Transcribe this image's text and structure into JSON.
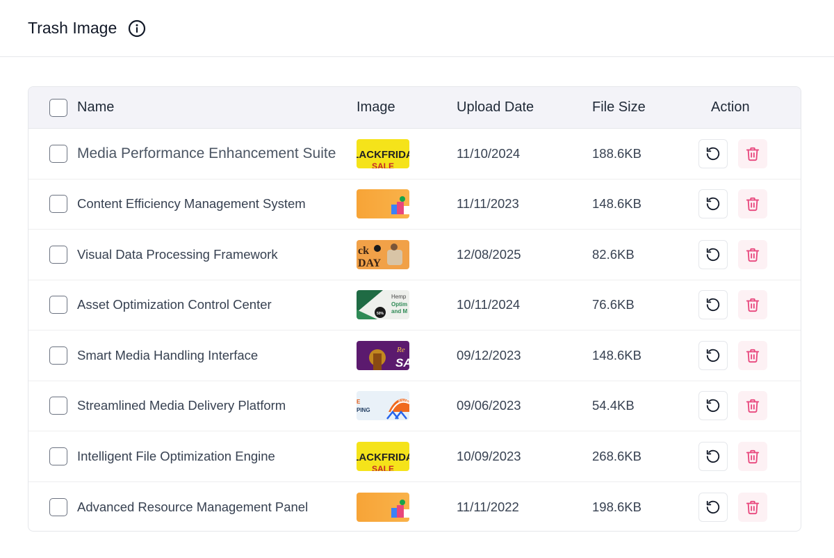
{
  "header": {
    "title": "Trash Image",
    "info_icon": "info-icon"
  },
  "table": {
    "columns": {
      "name": "Name",
      "image": "Image",
      "upload_date": "Upload Date",
      "file_size": "File Size",
      "action": "Action"
    },
    "rows": [
      {
        "name": "Media Performance Enhancement Suite",
        "thumb": "black-friday",
        "thumb_text": "LACKFRIDA SALE",
        "date": "11/10/2024",
        "size": "188.6KB"
      },
      {
        "name": "Content Efficiency Management System",
        "thumb": "orange-shopping",
        "thumb_text": "",
        "date": "11/11/2023",
        "size": "148.6KB"
      },
      {
        "name": "Visual Data Processing Framework",
        "thumb": "orange-day",
        "thumb_text": "ck DAY",
        "date": "12/08/2025",
        "size": "82.6KB"
      },
      {
        "name": "Asset Optimization Control Center",
        "thumb": "green-hemp",
        "thumb_text": "Hemp Optim and M",
        "date": "10/11/2024",
        "size": "76.6KB"
      },
      {
        "name": "Smart Media Handling Interface",
        "thumb": "purple-sale",
        "thumb_text": "Re SA",
        "date": "09/12/2023",
        "size": "148.6KB"
      },
      {
        "name": "Streamlined Media Delivery Platform",
        "thumb": "store-shipping",
        "thumb_text": "E PING STORE",
        "date": "09/06/2023",
        "size": "54.4KB"
      },
      {
        "name": "Intelligent File Optimization Engine",
        "thumb": "black-friday",
        "thumb_text": "LACKFRIDA SALE",
        "date": "10/09/2023",
        "size": "268.6KB"
      },
      {
        "name": "Advanced Resource Management Panel",
        "thumb": "orange-shopping",
        "thumb_text": "",
        "date": "11/11/2022",
        "size": "198.6KB"
      }
    ],
    "action_icons": [
      "restore-icon",
      "trash-icon"
    ]
  },
  "colors": {
    "header_bg": "#f3f3f8",
    "delete_bg": "#fdf1f4",
    "delete_icon": "#e8467c",
    "border": "#e5e7eb"
  }
}
